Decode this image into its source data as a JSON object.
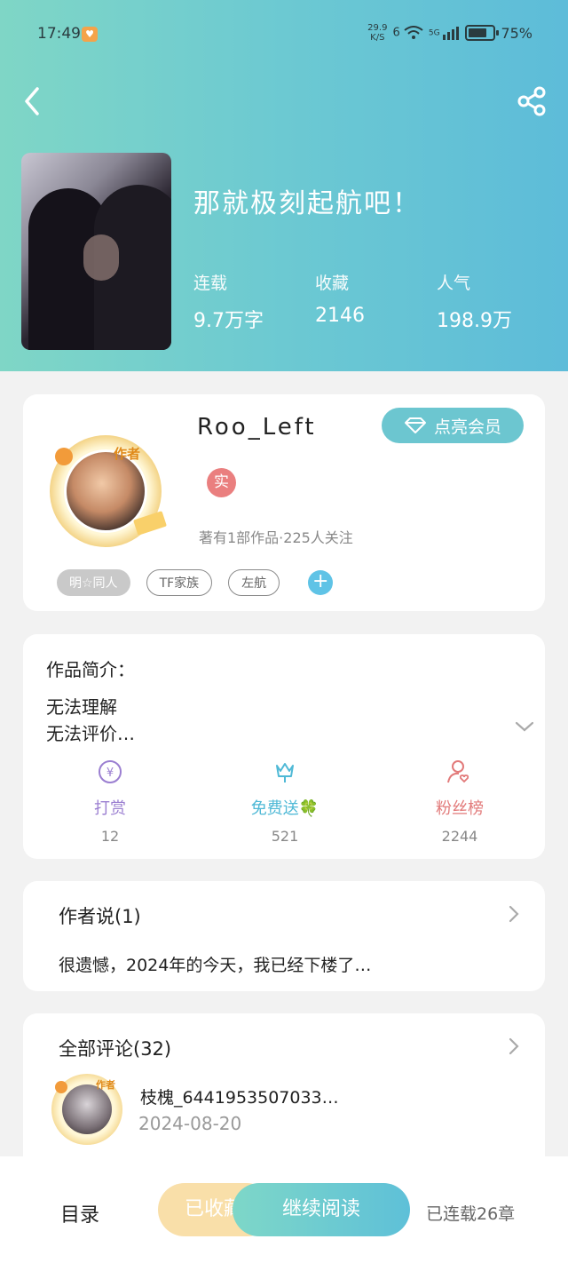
{
  "status": {
    "time": "17:49",
    "speed_top": "29.9",
    "speed_bottom": "K/S",
    "network": "6",
    "net_5g": "5G",
    "battery": "75%"
  },
  "book": {
    "title": "那就极刻起航吧！",
    "stats": [
      {
        "label": "连载",
        "value": "9.7万字"
      },
      {
        "label": "收藏",
        "value": "2146"
      },
      {
        "label": "人气",
        "value": "198.9万"
      }
    ]
  },
  "author": {
    "name": "Roo_Left",
    "tag": "作者",
    "vip_label": "点亮会员",
    "real_badge": "实",
    "meta": "著有1部作品·225人关注",
    "tags": [
      "明☆同人",
      "TF家族",
      "左航"
    ],
    "add": "+"
  },
  "intro": {
    "label": "作品简介：",
    "lines": [
      "无法理解",
      "无法评价…"
    ]
  },
  "actions": [
    {
      "label": "打赏",
      "count": "12",
      "color": "#9b7fd1"
    },
    {
      "label": "免费送🍀",
      "count": "521",
      "color": "#4fb9d6"
    },
    {
      "label": "粉丝榜",
      "count": "2244",
      "color": "#e27a7a"
    }
  ],
  "author_says": {
    "title": "作者说(1)",
    "text": "很遗憾，2024年的今天，我已经下楼了…"
  },
  "comments": {
    "title": "全部评论(32)",
    "first": {
      "name": "枝槐_6441953507033…",
      "date": "2024-08-20",
      "tag": "作者"
    }
  },
  "bottom": {
    "catalog": "目录",
    "collected": "已收藏",
    "continue": "继续阅读",
    "serial": "已连载26章"
  }
}
